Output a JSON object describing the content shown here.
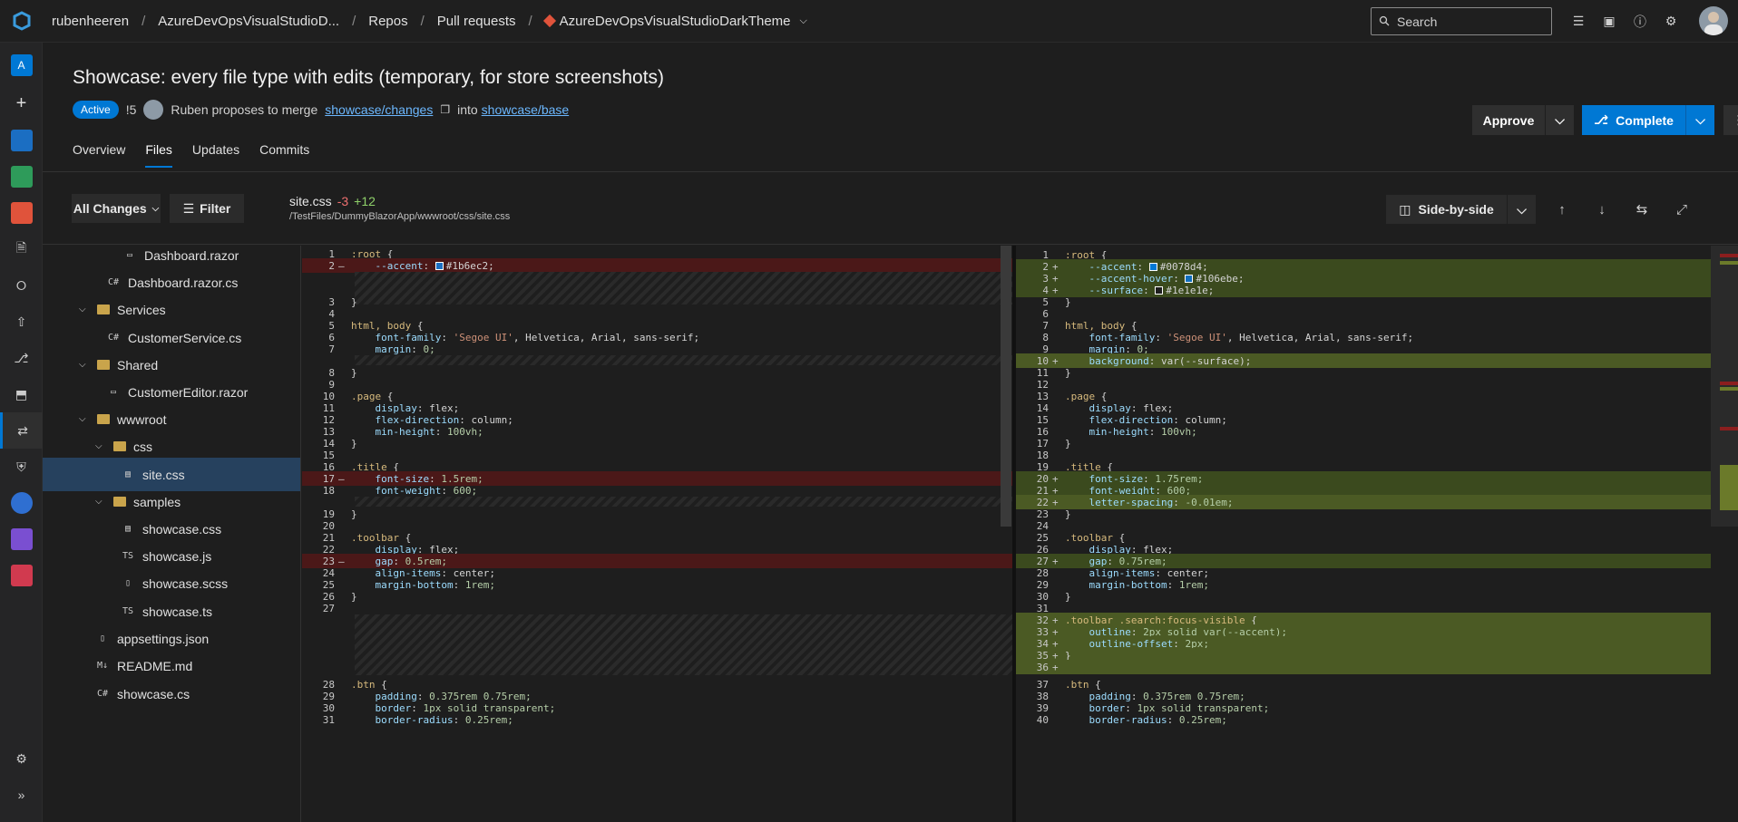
{
  "topbar": {
    "breadcrumbs": [
      "rubenheeren",
      "AzureDevOpsVisualStudioD...",
      "Repos",
      "Pull requests",
      "AzureDevOpsVisualStudioDarkTheme"
    ],
    "search_placeholder": "Search"
  },
  "pr": {
    "title": "Showcase: every file type with edits (temporary, for store screenshots)",
    "status": "Active",
    "id": "!5",
    "author_text": "Ruben proposes to merge",
    "source_branch": "showcase/changes",
    "into_text": "into",
    "target_branch": "showcase/base",
    "tabs": [
      "Overview",
      "Files",
      "Updates",
      "Commits"
    ],
    "active_tab": "Files",
    "approve_label": "Approve",
    "complete_label": "Complete"
  },
  "toolbar": {
    "all_changes": "All Changes",
    "filter": "Filter",
    "file_name": "site.css",
    "deletions": "-3",
    "additions": "+12",
    "file_path": "/TestFiles/DummyBlazorApp/wwwroot/css/site.css",
    "view_mode": "Side-by-side"
  },
  "tree": [
    {
      "label": "Dashboard.razor",
      "type": "file",
      "icon": "razor"
    },
    {
      "label": "Dashboard.razor.cs",
      "type": "file",
      "icon": "C#"
    },
    {
      "label": "Services",
      "type": "folder"
    },
    {
      "label": "CustomerService.cs",
      "type": "file",
      "icon": "C#"
    },
    {
      "label": "Shared",
      "type": "folder"
    },
    {
      "label": "CustomerEditor.razor",
      "type": "file",
      "icon": "razor"
    },
    {
      "label": "wwwroot",
      "type": "folder"
    },
    {
      "label": "css",
      "type": "folder"
    },
    {
      "label": "site.css",
      "type": "file",
      "icon": "css",
      "selected": true
    },
    {
      "label": "samples",
      "type": "folder"
    },
    {
      "label": "showcase.css",
      "type": "file",
      "icon": "css"
    },
    {
      "label": "showcase.js",
      "type": "file",
      "icon": "TS"
    },
    {
      "label": "showcase.scss",
      "type": "file",
      "icon": "file"
    },
    {
      "label": "showcase.ts",
      "type": "file",
      "icon": "TS"
    },
    {
      "label": "appsettings.json",
      "type": "file",
      "icon": "file"
    },
    {
      "label": "README.md",
      "type": "file",
      "icon": "M↓"
    },
    {
      "label": "showcase.cs",
      "type": "file",
      "icon": "C#"
    }
  ],
  "left_lines": [
    {
      "n": "1",
      "t": ":root {"
    },
    {
      "n": "2",
      "t": "    --accent: #1b6ec2;",
      "swatch": "#1b6ec2"
    },
    {
      "n": "3",
      "t": "}"
    },
    {
      "n": "4",
      "t": ""
    },
    {
      "n": "5",
      "t": "html, body {"
    },
    {
      "n": "6",
      "t": "    font-family: 'Segoe UI', Helvetica, Arial, sans-serif;"
    },
    {
      "n": "7",
      "t": "    margin: 0;"
    },
    {
      "n": "8",
      "t": "}"
    },
    {
      "n": "9",
      "t": ""
    },
    {
      "n": "10",
      "t": ".page {"
    },
    {
      "n": "11",
      "t": "    display: flex;"
    },
    {
      "n": "12",
      "t": "    flex-direction: column;"
    },
    {
      "n": "13",
      "t": "    min-height: 100vh;"
    },
    {
      "n": "14",
      "t": "}"
    },
    {
      "n": "15",
      "t": ""
    },
    {
      "n": "16",
      "t": ".title {"
    },
    {
      "n": "17",
      "t": "    font-size: 1.5rem;"
    },
    {
      "n": "18",
      "t": "    font-weight: 600;"
    },
    {
      "n": "19",
      "t": "}"
    },
    {
      "n": "20",
      "t": ""
    },
    {
      "n": "21",
      "t": ".toolbar {"
    },
    {
      "n": "22",
      "t": "    display: flex;"
    },
    {
      "n": "23",
      "t": "    gap: 0.5rem;"
    },
    {
      "n": "24",
      "t": "    align-items: center;"
    },
    {
      "n": "25",
      "t": "    margin-bottom: 1rem;"
    },
    {
      "n": "26",
      "t": "}"
    },
    {
      "n": "27",
      "t": ""
    },
    {
      "n": "28",
      "t": ".btn {"
    },
    {
      "n": "29",
      "t": "    padding: 0.375rem 0.75rem;"
    },
    {
      "n": "30",
      "t": "    border: 1px solid transparent;"
    },
    {
      "n": "31",
      "t": "    border-radius: 0.25rem;"
    }
  ],
  "right_lines": [
    {
      "n": "1",
      "t": ":root {"
    },
    {
      "n": "2",
      "t": "    --accent: #0078d4;",
      "swatch": "#0078d4"
    },
    {
      "n": "3",
      "t": "    --accent-hover: #106ebe;",
      "swatch": "#106ebe"
    },
    {
      "n": "4",
      "t": "    --surface: #1e1e1e;",
      "swatch": "#1e1e1e"
    },
    {
      "n": "5",
      "t": "}"
    },
    {
      "n": "6",
      "t": ""
    },
    {
      "n": "7",
      "t": "html, body {"
    },
    {
      "n": "8",
      "t": "    font-family: 'Segoe UI', Helvetica, Arial, sans-serif;"
    },
    {
      "n": "9",
      "t": "    margin: 0;"
    },
    {
      "n": "10",
      "t": "    background: var(--surface);"
    },
    {
      "n": "11",
      "t": "}"
    },
    {
      "n": "12",
      "t": ""
    },
    {
      "n": "13",
      "t": ".page {"
    },
    {
      "n": "14",
      "t": "    display: flex;"
    },
    {
      "n": "15",
      "t": "    flex-direction: column;"
    },
    {
      "n": "16",
      "t": "    min-height: 100vh;"
    },
    {
      "n": "17",
      "t": "}"
    },
    {
      "n": "18",
      "t": ""
    },
    {
      "n": "19",
      "t": ".title {"
    },
    {
      "n": "20",
      "t": "    font-size: 1.75rem;"
    },
    {
      "n": "21",
      "t": "    font-weight: 600;"
    },
    {
      "n": "22",
      "t": "    letter-spacing: -0.01em;"
    },
    {
      "n": "23",
      "t": "}"
    },
    {
      "n": "24",
      "t": ""
    },
    {
      "n": "25",
      "t": ".toolbar {"
    },
    {
      "n": "26",
      "t": "    display: flex;"
    },
    {
      "n": "27",
      "t": "    gap: 0.75rem;"
    },
    {
      "n": "28",
      "t": "    align-items: center;"
    },
    {
      "n": "29",
      "t": "    margin-bottom: 1rem;"
    },
    {
      "n": "30",
      "t": "}"
    },
    {
      "n": "31",
      "t": ""
    },
    {
      "n": "32",
      "t": ".toolbar .search:focus-visible {"
    },
    {
      "n": "33",
      "t": "    outline: 2px solid var(--accent);"
    },
    {
      "n": "34",
      "t": "    outline-offset: 2px;"
    },
    {
      "n": "35",
      "t": "}"
    },
    {
      "n": "36",
      "t": ""
    },
    {
      "n": "37",
      "t": ".btn {"
    },
    {
      "n": "38",
      "t": "    padding: 0.375rem 0.75rem;"
    },
    {
      "n": "39",
      "t": "    border: 1px solid transparent;"
    },
    {
      "n": "40",
      "t": "    border-radius: 0.25rem;"
    }
  ]
}
